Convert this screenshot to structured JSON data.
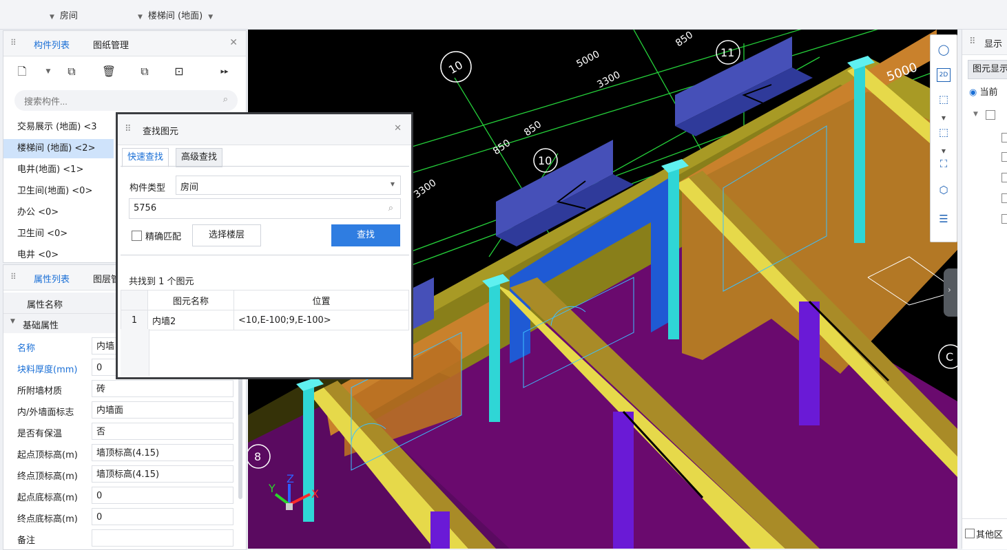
{
  "topbar": {
    "combo1": "房间",
    "combo2": "楼梯间 (地面)"
  },
  "component_panel": {
    "tabs": [
      "构件列表",
      "图纸管理"
    ],
    "search_placeholder": "搜索构件...",
    "items": [
      {
        "label": "交易展示 (地面)  <3",
        "selected": false
      },
      {
        "label": "楼梯间 (地面)  <2>",
        "selected": true
      },
      {
        "label": "电井(地面)  <1>",
        "selected": false
      },
      {
        "label": "卫生间(地面)  <0>",
        "selected": false
      },
      {
        "label": "办公 <0>",
        "selected": false
      },
      {
        "label": "卫生间 <0>",
        "selected": false
      },
      {
        "label": "电井 <0>",
        "selected": false
      }
    ]
  },
  "property_panel": {
    "tabs": [
      "属性列表",
      "图层管"
    ],
    "header": "属性名称",
    "group": "基础属性",
    "rows": [
      {
        "name": "名称",
        "value": "内墙",
        "blue": true
      },
      {
        "name": "块料厚度(mm)",
        "value": "0",
        "blue": true
      },
      {
        "name": "所附墙材质",
        "value": "砖",
        "blue": false
      },
      {
        "name": "内/外墙面标志",
        "value": "内墙面",
        "blue": false
      },
      {
        "name": "是否有保温",
        "value": "否",
        "blue": false
      },
      {
        "name": "起点顶标高(m)",
        "value": "墙顶标高(4.15)",
        "blue": false
      },
      {
        "name": "终点顶标高(m)",
        "value": "墙顶标高(4.15)",
        "blue": false
      },
      {
        "name": "起点底标高(m)",
        "value": "0",
        "blue": false
      },
      {
        "name": "终点底标高(m)",
        "value": "0",
        "blue": false
      },
      {
        "name": "备注",
        "value": "",
        "blue": false
      }
    ]
  },
  "dialog": {
    "title": "查找图元",
    "tabs": [
      "快速查找",
      "高级查找"
    ],
    "type_label": "构件类型",
    "type_value": "房间",
    "search_value": "5756",
    "exact_match_label": "精确匹配",
    "select_floor_label": "选择楼层",
    "find_label": "查找",
    "result_summary": "共找到 1 个图元",
    "table": {
      "columns": [
        "图元名称",
        "位置"
      ],
      "rows": [
        {
          "index": "1",
          "name": "内墙2",
          "position": "<10,E-100;9,E-100>"
        }
      ]
    }
  },
  "viewport": {
    "dims": [
      "5000",
      "3300",
      "850",
      "850",
      "850",
      "3300",
      "5000"
    ],
    "axis_labels": [
      "10",
      "11",
      "10",
      "C",
      "8"
    ],
    "axes": [
      "X",
      "Y",
      "Z"
    ]
  },
  "right_panel": {
    "title": "显示",
    "tab": "图元显示",
    "radio": "当前",
    "footer": "其他区"
  },
  "colors": {
    "accent": "#1a6fd6",
    "wall_yellow": "#e6d94a",
    "wall_orange": "#c9812c",
    "floor_purple": "#6a0a6e",
    "slab_blue": "#4650b8",
    "column_cyan": "#2fd6d6",
    "grid_green": "#25d03a"
  }
}
